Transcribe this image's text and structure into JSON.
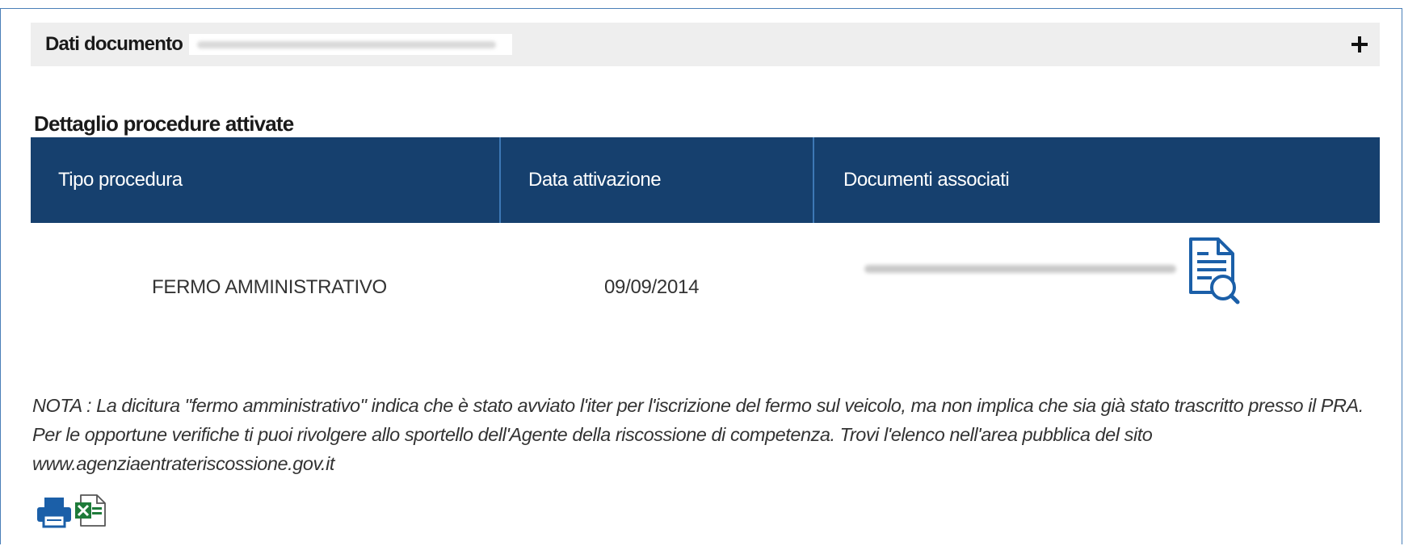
{
  "accordion": {
    "label": "Dati documento",
    "toggle_symbol": "+"
  },
  "section": {
    "title": "Dettaglio procedure attivate"
  },
  "table": {
    "columns": [
      "Tipo procedura",
      "Data attivazione",
      "Documenti associati"
    ],
    "rows": [
      {
        "tipo_procedura": "FERMO AMMINISTRATIVO",
        "data_attivazione": "09/09/2014",
        "documento_icon": "document-search-icon"
      }
    ]
  },
  "note": {
    "text": "NOTA : La dicitura \"fermo amministrativo\" indica che è stato avviato l'iter per l'iscrizione del fermo sul veicolo, ma non implica che sia già stato trascritto presso il PRA. Per le opportune verifiche ti puoi rivolgere allo sportello dell'Agente della riscossione di competenza. Trovi l'elenco nell'area pubblica del sito www.agenziaentrateriscossione.gov.it"
  },
  "actions": {
    "print_icon": "printer-icon",
    "excel_icon": "excel-export-icon"
  },
  "colors": {
    "header_bg": "#16406e",
    "column_divider": "#3d78b5",
    "accordion_bg": "#eeeeee",
    "frame_border": "#4a7fb8",
    "icon_blue": "#1b5fa8",
    "excel_green": "#1e7b3a"
  }
}
